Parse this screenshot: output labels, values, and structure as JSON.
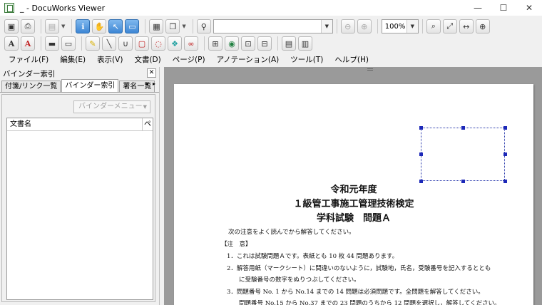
{
  "window": {
    "title": "_ - DocuWorks Viewer",
    "minimize": "—",
    "maximize": "☐",
    "close": "✕"
  },
  "toolbar": {
    "zoom_value": "100%",
    "page_combo_value": "",
    "text_a_bold": "A",
    "text_a_red": "A"
  },
  "menu": {
    "items": [
      {
        "label": "ファイル(F)"
      },
      {
        "label": "編集(E)"
      },
      {
        "label": "表示(V)"
      },
      {
        "label": "文書(D)"
      },
      {
        "label": "ページ(P)"
      },
      {
        "label": "アノテーション(A)"
      },
      {
        "label": "ツール(T)"
      },
      {
        "label": "ヘルプ(H)"
      }
    ]
  },
  "pane": {
    "title": "バインダー索引",
    "close": "✕",
    "tabs": [
      {
        "label": "付箋/リンク一覧",
        "active": false
      },
      {
        "label": "バインダー索引",
        "active": true
      },
      {
        "label": "署名一覧",
        "active": false
      }
    ],
    "tab_scroll_left": "◂",
    "tab_scroll_right": "▸",
    "binder_menu": "バインダーメニュー",
    "list_col_name": "文書名",
    "list_col_page": "ペ"
  },
  "document": {
    "title_line1": "令和元年度",
    "title_line2": "１級管工事施工管理技術検定",
    "title_line3": "学科試験　問題Ａ",
    "intro": "次の注意をよく読んでから解答してください。",
    "notes_header": "【注　意】",
    "notes": [
      "1．これは試験問題Ａです。表紙とも 10 枚 44 問題あります。",
      "2．解答用紙（マークシート）に間違いのないように，試験地，氏名，受験番号を記入するととも",
      "　　に受験番号の数字をぬりつぶしてください。",
      "3．問題番号 No. 1 から No.14 までの 14 問題は必須問題です。全問題を解答してください。",
      "　　問題番号 No.15 から No.37 までの 23 問題のうちから 12 問題を選択し，解答してください。"
    ]
  }
}
